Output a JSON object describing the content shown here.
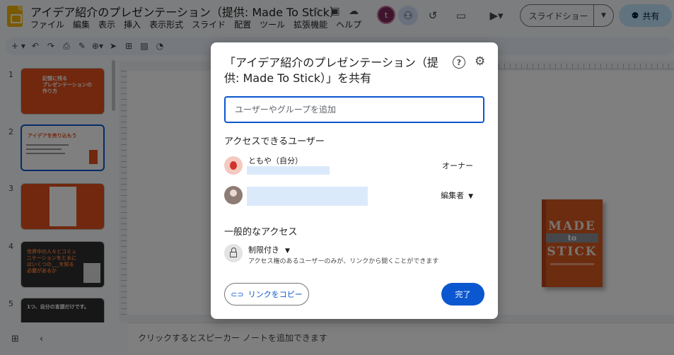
{
  "app": {
    "title": "アイデア紹介のプレゼンテーション（提供: Made To Stick）",
    "menu": [
      "ファイル",
      "編集",
      "表示",
      "挿入",
      "表示形式",
      "スライド",
      "配置",
      "ツール",
      "拡張機能",
      "ヘルプ"
    ],
    "avatar_letter": "t",
    "slideshow_label": "スライドショー",
    "share_label": "共有"
  },
  "filmstrip": {
    "slides": [
      {
        "num": "1",
        "text": "記憶に残る\nプレゼンテーションの\n作り方"
      },
      {
        "num": "2",
        "text": "アイデアを売り込もう"
      },
      {
        "num": "3",
        "text": ""
      },
      {
        "num": "4",
        "text": "世界中の人々とコミュ\nニケーションをとるに\nはいくつの___を知る\n必要があるか"
      },
      {
        "num": "5",
        "text": "1つ、自分の言語だけです。"
      }
    ]
  },
  "canvas": {
    "book": {
      "line1": "MADE",
      "line2": "to",
      "line3": "STICK"
    }
  },
  "notes": {
    "placeholder": "クリックするとスピーカー ノートを追加できます"
  },
  "share_dialog": {
    "title": "「アイデア紹介のプレゼンテーション（提供: Made To Stick）」を共有",
    "input_placeholder": "ユーザーやグループを追加",
    "people_heading": "アクセスできるユーザー",
    "users": [
      {
        "name": "ともや（自分）",
        "role": "オーナー"
      },
      {
        "name": "",
        "role": "編集者"
      }
    ],
    "general_heading": "一般的なアクセス",
    "restriction": "制限付き",
    "restriction_desc": "アクセス権のあるユーザーのみが、リンクから開くことができます",
    "copy_link_label": "リンクをコピー",
    "done_label": "完了"
  }
}
